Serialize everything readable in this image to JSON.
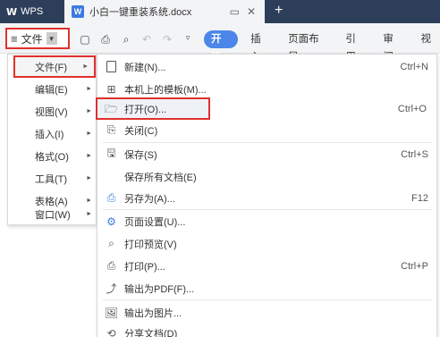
{
  "titlebar": {
    "app_tab": "WPS",
    "doc_tab": "小白一键重装系统.docx",
    "new_tab": "+"
  },
  "ribbon": {
    "file_button": "文件",
    "tabs": [
      "开始",
      "插入",
      "页面布局",
      "引用",
      "审阅",
      "视"
    ]
  },
  "left_menu": [
    {
      "label": "文件(F)",
      "selected": true
    },
    {
      "label": "编辑(E)"
    },
    {
      "label": "视图(V)"
    },
    {
      "label": "插入(I)"
    },
    {
      "label": "格式(O)"
    },
    {
      "label": "工具(T)"
    },
    {
      "label": "表格(A)"
    },
    {
      "label": "窗口(W)"
    }
  ],
  "file_submenu": [
    {
      "label": "新建(N)...",
      "shortcut": "Ctrl+N",
      "icon": "new-doc-icon"
    },
    {
      "label": "本机上的模板(M)...",
      "shortcut": "",
      "icon": "template-icon"
    },
    {
      "label": "打开(O)...",
      "shortcut": "Ctrl+O",
      "icon": "folder-open-icon",
      "highlight": true
    },
    {
      "label": "关闭(C)",
      "shortcut": "",
      "icon": "close-doc-icon"
    },
    {
      "label": "保存(S)",
      "shortcut": "Ctrl+S",
      "icon": "save-icon"
    },
    {
      "label": "保存所有文档(E)",
      "shortcut": "",
      "icon": ""
    },
    {
      "label": "另存为(A)...",
      "shortcut": "F12",
      "icon": "save-as-icon"
    },
    {
      "label": "页面设置(U)...",
      "shortcut": "",
      "icon": "page-setup-icon"
    },
    {
      "label": "打印预览(V)",
      "shortcut": "",
      "icon": "print-preview-icon"
    },
    {
      "label": "打印(P)...",
      "shortcut": "Ctrl+P",
      "icon": "printer-icon"
    },
    {
      "label": "输出为PDF(F)...",
      "shortcut": "",
      "icon": "export-pdf-icon"
    },
    {
      "label": "输出为图片...",
      "shortcut": "",
      "icon": "export-image-icon"
    },
    {
      "label": "分享文档(D)",
      "shortcut": "",
      "icon": "share-icon"
    }
  ],
  "colors": {
    "titlebar": "#2d3e5a",
    "accent": "#4c86e8",
    "highlight_border": "#e0312d"
  }
}
